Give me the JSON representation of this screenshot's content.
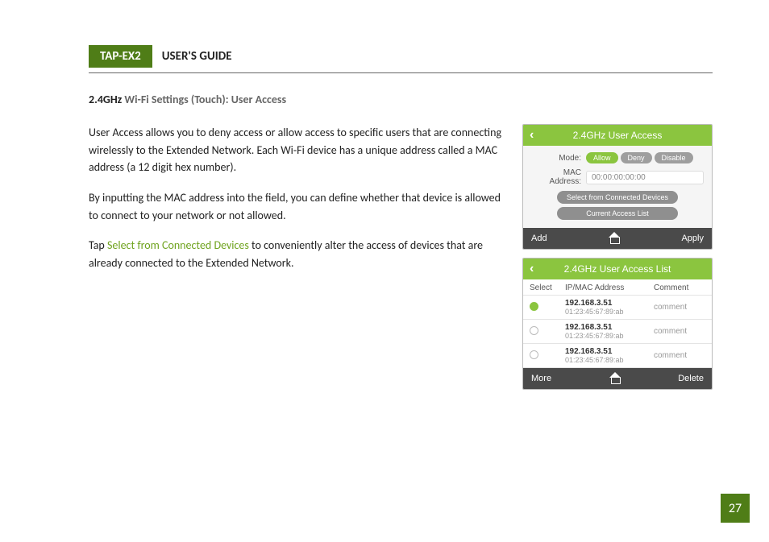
{
  "header": {
    "badge": "TAP-EX2",
    "title": "USER'S GUIDE"
  },
  "section_title": {
    "lead": "2.4GHz",
    "rest": " Wi-Fi Settings (Touch): User Access"
  },
  "paragraphs": {
    "p1": "User Access allows you to deny access or allow access to specific users that are connecting wirelessly to the Extended Network. Each Wi-Fi device has a unique address called a MAC address (a 12 digit hex number).",
    "p2": "By inputting the MAC address into the field, you can define whether that device is allowed to connect to your network or not allowed.",
    "p3a": "Tap ",
    "p3_link": "Select from Connected Devices",
    "p3b": " to conveniently alter the access of devices that are already connected to the Extended Network."
  },
  "shot1": {
    "title": "2.4GHz User Access",
    "mode_label": "Mode:",
    "mode_allow": "Allow",
    "mode_deny": "Deny",
    "mode_disable": "Disable",
    "mac_label": "MAC Address:",
    "mac_value": "00:00:00:00:00",
    "btn_select": "Select from Connected Devices",
    "btn_list": "Current Access List",
    "footer_left": "Add",
    "footer_right": "Apply"
  },
  "shot2": {
    "title": "2.4GHz User Access List",
    "col_select": "Select",
    "col_ip": "IP/MAC Address",
    "col_comment": "Comment",
    "rows": [
      {
        "ip": "192.168.3.51",
        "mac": "01:23:45:67:89:ab",
        "comment": "comment",
        "selected": true
      },
      {
        "ip": "192.168.3.51",
        "mac": "01:23:45:67:89:ab",
        "comment": "comment",
        "selected": false
      },
      {
        "ip": "192.168.3.51",
        "mac": "01:23:45:67:89:ab",
        "comment": "comment",
        "selected": false
      }
    ],
    "footer_left": "More",
    "footer_right": "Delete"
  },
  "page_number": "27"
}
